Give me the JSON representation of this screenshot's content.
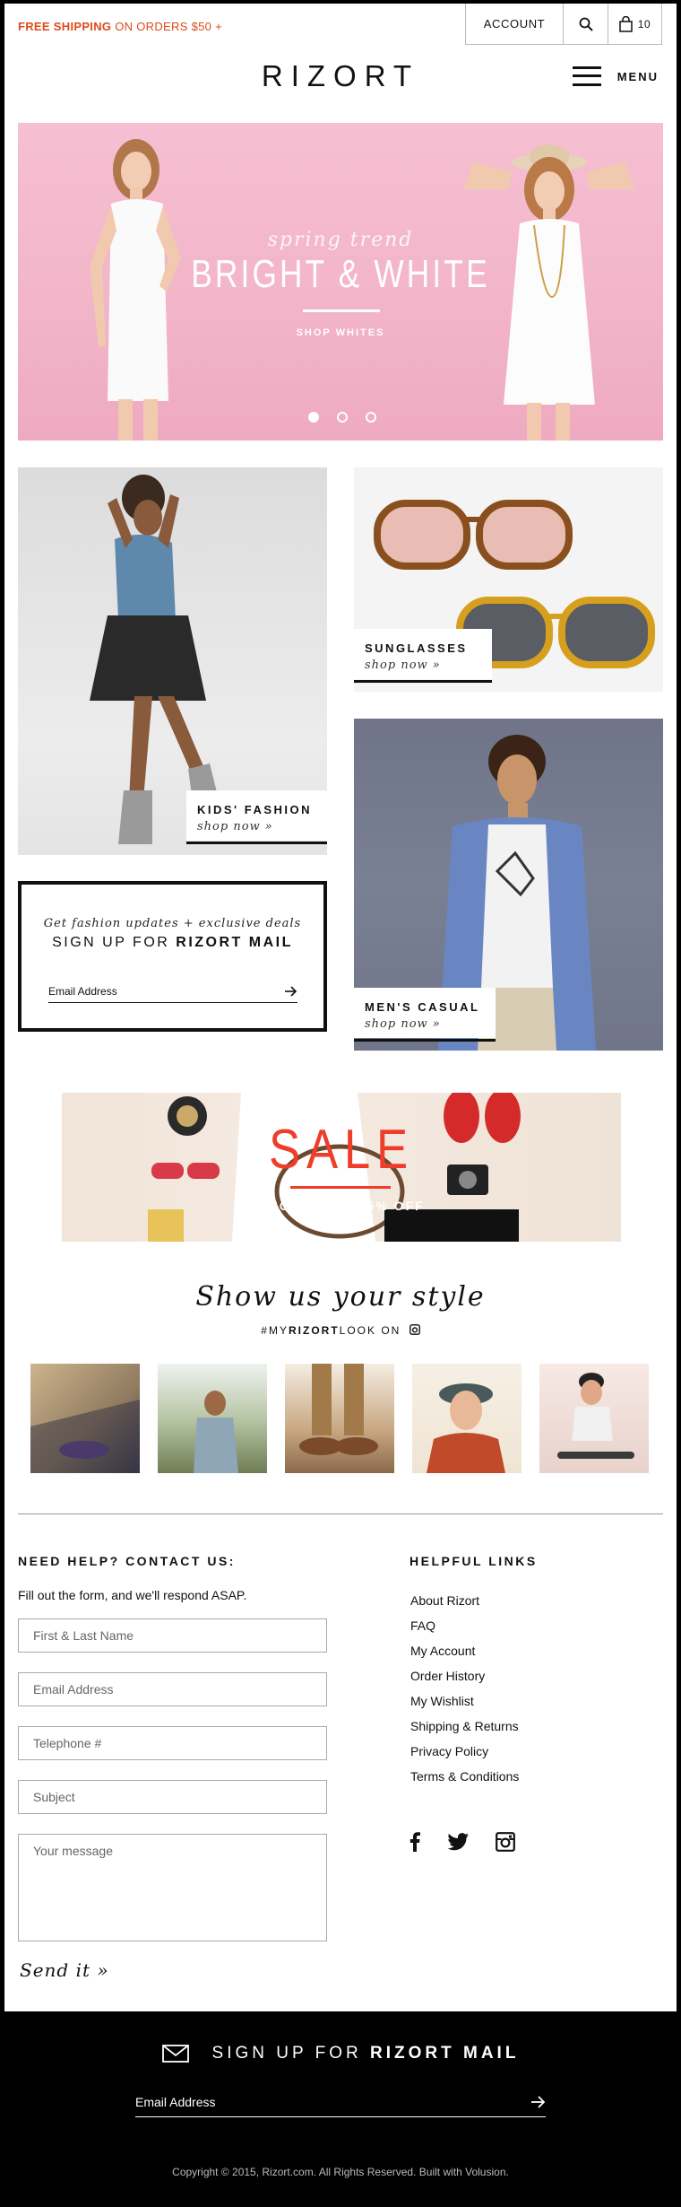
{
  "topbar": {
    "shipping_bold": "FREE SHIPPING",
    "shipping_rest": "ON ORDERS $50 +",
    "account_label": "ACCOUNT",
    "cart_count": "10"
  },
  "header": {
    "logo": "RIZORT",
    "menu_label": "MENU"
  },
  "hero": {
    "script": "spring trend",
    "title": "BRIGHT & WHITE",
    "cta": "SHOP WHITES",
    "slides": 3,
    "active_slide": 1
  },
  "tiles": {
    "kids": {
      "title": "KIDS' FASHION",
      "link": "shop now »"
    },
    "sunglasses": {
      "title": "SUNGLASSES",
      "link": "shop now »"
    },
    "mens": {
      "title": "MEN'S CASUAL",
      "link": "shop now »"
    }
  },
  "signup_box": {
    "script": "Get fashion updates + exclusive deals",
    "head_prefix": "SIGN UP FOR",
    "head_brand": "RIZORT MAIL",
    "email_placeholder": "Email Address"
  },
  "sale": {
    "title": "SALE",
    "subtitle": "SHOP UP TO 75% OFF"
  },
  "show_style": {
    "title": "Show us your style",
    "hashtag_prefix": "#MY",
    "hashtag_brand": "RIZORT",
    "hashtag_suffix": "LOOK ON"
  },
  "contact": {
    "heading": "NEED HELP? CONTACT US:",
    "subtext": "Fill out the form, and we'll respond ASAP.",
    "fields": {
      "name": "First & Last Name",
      "email": "Email Address",
      "phone": "Telephone #",
      "subject": "Subject",
      "message": "Your message"
    },
    "send_label": "Send it »"
  },
  "helpful_links": {
    "heading": "HELPFUL LINKS",
    "items": [
      "About Rizort",
      "FAQ",
      "My Account",
      "Order History",
      "My Wishlist",
      "Shipping & Returns",
      "Privacy Policy",
      "Terms & Conditions"
    ]
  },
  "footer": {
    "head_prefix": "SIGN UP FOR",
    "head_brand": "RIZORT MAIL",
    "email_placeholder": "Email Address",
    "copyright": "Copyright © 2015, Rizort.com. All Rights Reserved. Built with Volusion."
  },
  "colors": {
    "accent": "#e04a1d",
    "sale_red": "#ee3d2b",
    "hero_pink": "#f4b8cb",
    "footer_bg": "#000000"
  },
  "icons": [
    "search-icon",
    "cart-icon",
    "hamburger-icon",
    "arrow-right-icon",
    "instagram-icon",
    "facebook-icon",
    "twitter-icon",
    "envelope-icon"
  ]
}
